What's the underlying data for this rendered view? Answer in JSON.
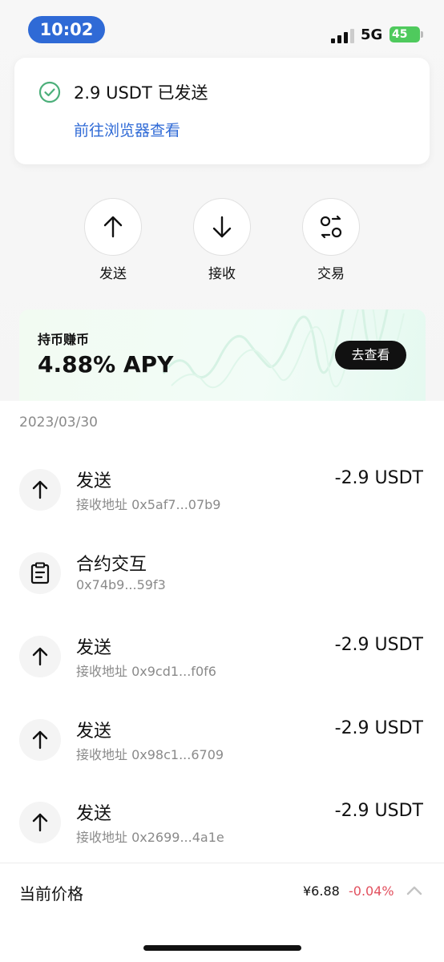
{
  "status_bar": {
    "time": "10:02",
    "network": "5G",
    "battery": "45"
  },
  "toast": {
    "message": "2.9 USDT 已发送",
    "link": "前往浏览器查看"
  },
  "actions": [
    {
      "label": "发送",
      "icon": "arrow-up-icon"
    },
    {
      "label": "接收",
      "icon": "arrow-down-icon"
    },
    {
      "label": "交易",
      "icon": "swap-icon"
    }
  ],
  "banner": {
    "subtitle": "持币赚币",
    "apy": "4.88% APY",
    "button": "去查看"
  },
  "list": {
    "date": "2023/03/30",
    "items": [
      {
        "title": "发送",
        "subtitle": "接收地址 0x5af7...07b9",
        "amount": "-2.9 USDT",
        "icon": "arrow-up-icon"
      },
      {
        "title": "合约交互",
        "subtitle": "0x74b9...59f3",
        "amount": "",
        "icon": "clipboard-icon"
      },
      {
        "title": "发送",
        "subtitle": "接收地址 0x9cd1...f0f6",
        "amount": "-2.9 USDT",
        "icon": "arrow-up-icon"
      },
      {
        "title": "发送",
        "subtitle": "接收地址 0x98c1...6709",
        "amount": "-2.9 USDT",
        "icon": "arrow-up-icon"
      },
      {
        "title": "发送",
        "subtitle": "接收地址 0x2699...4a1e",
        "amount": "-2.9 USDT",
        "icon": "arrow-up-icon"
      }
    ]
  },
  "price_bar": {
    "label": "当前价格",
    "price": "¥6.88",
    "change": "-0.04%"
  },
  "colors": {
    "accent_blue": "#2f6ad6",
    "success_green": "#4caf7a",
    "negative_red": "#e2505e",
    "battery_green": "#4fca5d"
  }
}
